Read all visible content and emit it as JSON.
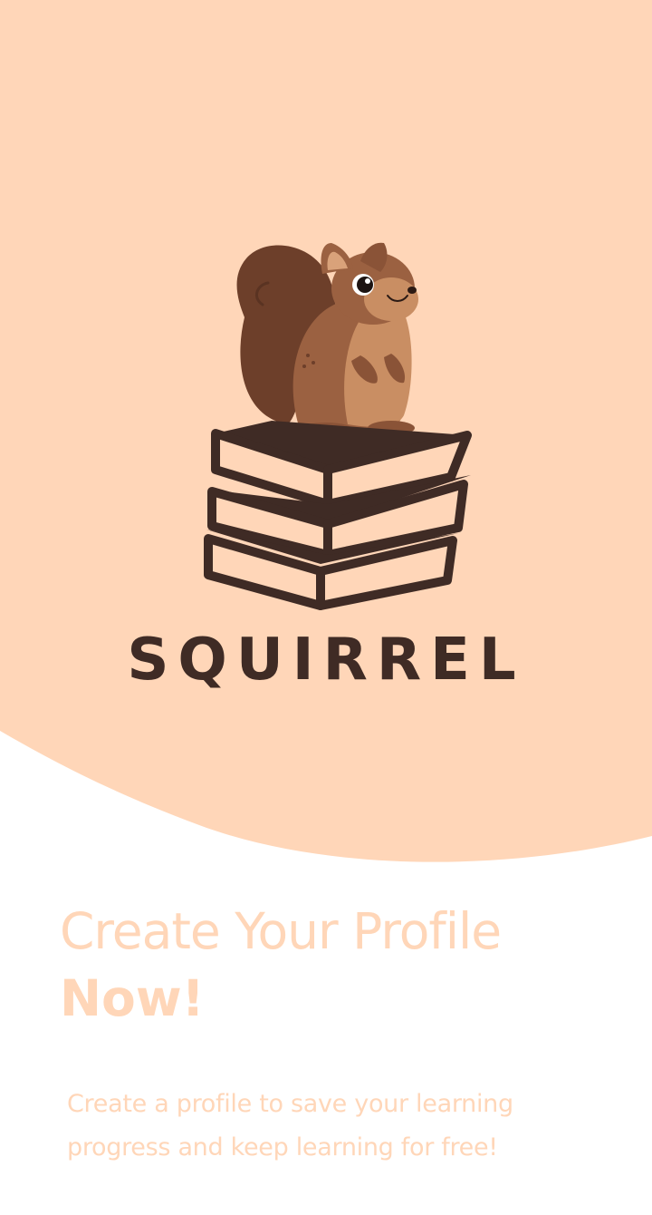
{
  "brand": {
    "name": "SQUIRREL"
  },
  "onboarding": {
    "headline_line1": "Create Your Profile",
    "headline_line2": "Now!",
    "description": "Create a profile to save your learning progress and keep learning for free!"
  },
  "colors": {
    "hero_background": "#ffd6b8",
    "brand_dark": "#3f2b25",
    "text_accent": "#ffd6b8",
    "page_background": "#ffffff"
  },
  "icons": {
    "logo": "squirrel-on-books-logo"
  }
}
